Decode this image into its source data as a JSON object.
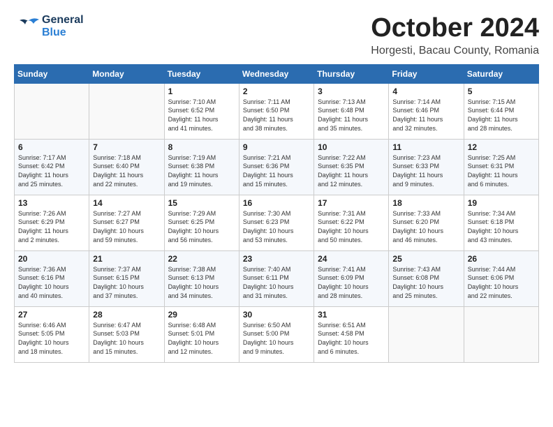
{
  "header": {
    "logo_general": "General",
    "logo_blue": "Blue",
    "month_title": "October 2024",
    "location": "Horgesti, Bacau County, Romania"
  },
  "calendar": {
    "days_of_week": [
      "Sunday",
      "Monday",
      "Tuesday",
      "Wednesday",
      "Thursday",
      "Friday",
      "Saturday"
    ],
    "weeks": [
      [
        {
          "day": "",
          "info": ""
        },
        {
          "day": "",
          "info": ""
        },
        {
          "day": "1",
          "info": "Sunrise: 7:10 AM\nSunset: 6:52 PM\nDaylight: 11 hours\nand 41 minutes."
        },
        {
          "day": "2",
          "info": "Sunrise: 7:11 AM\nSunset: 6:50 PM\nDaylight: 11 hours\nand 38 minutes."
        },
        {
          "day": "3",
          "info": "Sunrise: 7:13 AM\nSunset: 6:48 PM\nDaylight: 11 hours\nand 35 minutes."
        },
        {
          "day": "4",
          "info": "Sunrise: 7:14 AM\nSunset: 6:46 PM\nDaylight: 11 hours\nand 32 minutes."
        },
        {
          "day": "5",
          "info": "Sunrise: 7:15 AM\nSunset: 6:44 PM\nDaylight: 11 hours\nand 28 minutes."
        }
      ],
      [
        {
          "day": "6",
          "info": "Sunrise: 7:17 AM\nSunset: 6:42 PM\nDaylight: 11 hours\nand 25 minutes."
        },
        {
          "day": "7",
          "info": "Sunrise: 7:18 AM\nSunset: 6:40 PM\nDaylight: 11 hours\nand 22 minutes."
        },
        {
          "day": "8",
          "info": "Sunrise: 7:19 AM\nSunset: 6:38 PM\nDaylight: 11 hours\nand 19 minutes."
        },
        {
          "day": "9",
          "info": "Sunrise: 7:21 AM\nSunset: 6:36 PM\nDaylight: 11 hours\nand 15 minutes."
        },
        {
          "day": "10",
          "info": "Sunrise: 7:22 AM\nSunset: 6:35 PM\nDaylight: 11 hours\nand 12 minutes."
        },
        {
          "day": "11",
          "info": "Sunrise: 7:23 AM\nSunset: 6:33 PM\nDaylight: 11 hours\nand 9 minutes."
        },
        {
          "day": "12",
          "info": "Sunrise: 7:25 AM\nSunset: 6:31 PM\nDaylight: 11 hours\nand 6 minutes."
        }
      ],
      [
        {
          "day": "13",
          "info": "Sunrise: 7:26 AM\nSunset: 6:29 PM\nDaylight: 11 hours\nand 2 minutes."
        },
        {
          "day": "14",
          "info": "Sunrise: 7:27 AM\nSunset: 6:27 PM\nDaylight: 10 hours\nand 59 minutes."
        },
        {
          "day": "15",
          "info": "Sunrise: 7:29 AM\nSunset: 6:25 PM\nDaylight: 10 hours\nand 56 minutes."
        },
        {
          "day": "16",
          "info": "Sunrise: 7:30 AM\nSunset: 6:23 PM\nDaylight: 10 hours\nand 53 minutes."
        },
        {
          "day": "17",
          "info": "Sunrise: 7:31 AM\nSunset: 6:22 PM\nDaylight: 10 hours\nand 50 minutes."
        },
        {
          "day": "18",
          "info": "Sunrise: 7:33 AM\nSunset: 6:20 PM\nDaylight: 10 hours\nand 46 minutes."
        },
        {
          "day": "19",
          "info": "Sunrise: 7:34 AM\nSunset: 6:18 PM\nDaylight: 10 hours\nand 43 minutes."
        }
      ],
      [
        {
          "day": "20",
          "info": "Sunrise: 7:36 AM\nSunset: 6:16 PM\nDaylight: 10 hours\nand 40 minutes."
        },
        {
          "day": "21",
          "info": "Sunrise: 7:37 AM\nSunset: 6:15 PM\nDaylight: 10 hours\nand 37 minutes."
        },
        {
          "day": "22",
          "info": "Sunrise: 7:38 AM\nSunset: 6:13 PM\nDaylight: 10 hours\nand 34 minutes."
        },
        {
          "day": "23",
          "info": "Sunrise: 7:40 AM\nSunset: 6:11 PM\nDaylight: 10 hours\nand 31 minutes."
        },
        {
          "day": "24",
          "info": "Sunrise: 7:41 AM\nSunset: 6:09 PM\nDaylight: 10 hours\nand 28 minutes."
        },
        {
          "day": "25",
          "info": "Sunrise: 7:43 AM\nSunset: 6:08 PM\nDaylight: 10 hours\nand 25 minutes."
        },
        {
          "day": "26",
          "info": "Sunrise: 7:44 AM\nSunset: 6:06 PM\nDaylight: 10 hours\nand 22 minutes."
        }
      ],
      [
        {
          "day": "27",
          "info": "Sunrise: 6:46 AM\nSunset: 5:05 PM\nDaylight: 10 hours\nand 18 minutes."
        },
        {
          "day": "28",
          "info": "Sunrise: 6:47 AM\nSunset: 5:03 PM\nDaylight: 10 hours\nand 15 minutes."
        },
        {
          "day": "29",
          "info": "Sunrise: 6:48 AM\nSunset: 5:01 PM\nDaylight: 10 hours\nand 12 minutes."
        },
        {
          "day": "30",
          "info": "Sunrise: 6:50 AM\nSunset: 5:00 PM\nDaylight: 10 hours\nand 9 minutes."
        },
        {
          "day": "31",
          "info": "Sunrise: 6:51 AM\nSunset: 4:58 PM\nDaylight: 10 hours\nand 6 minutes."
        },
        {
          "day": "",
          "info": ""
        },
        {
          "day": "",
          "info": ""
        }
      ]
    ]
  }
}
